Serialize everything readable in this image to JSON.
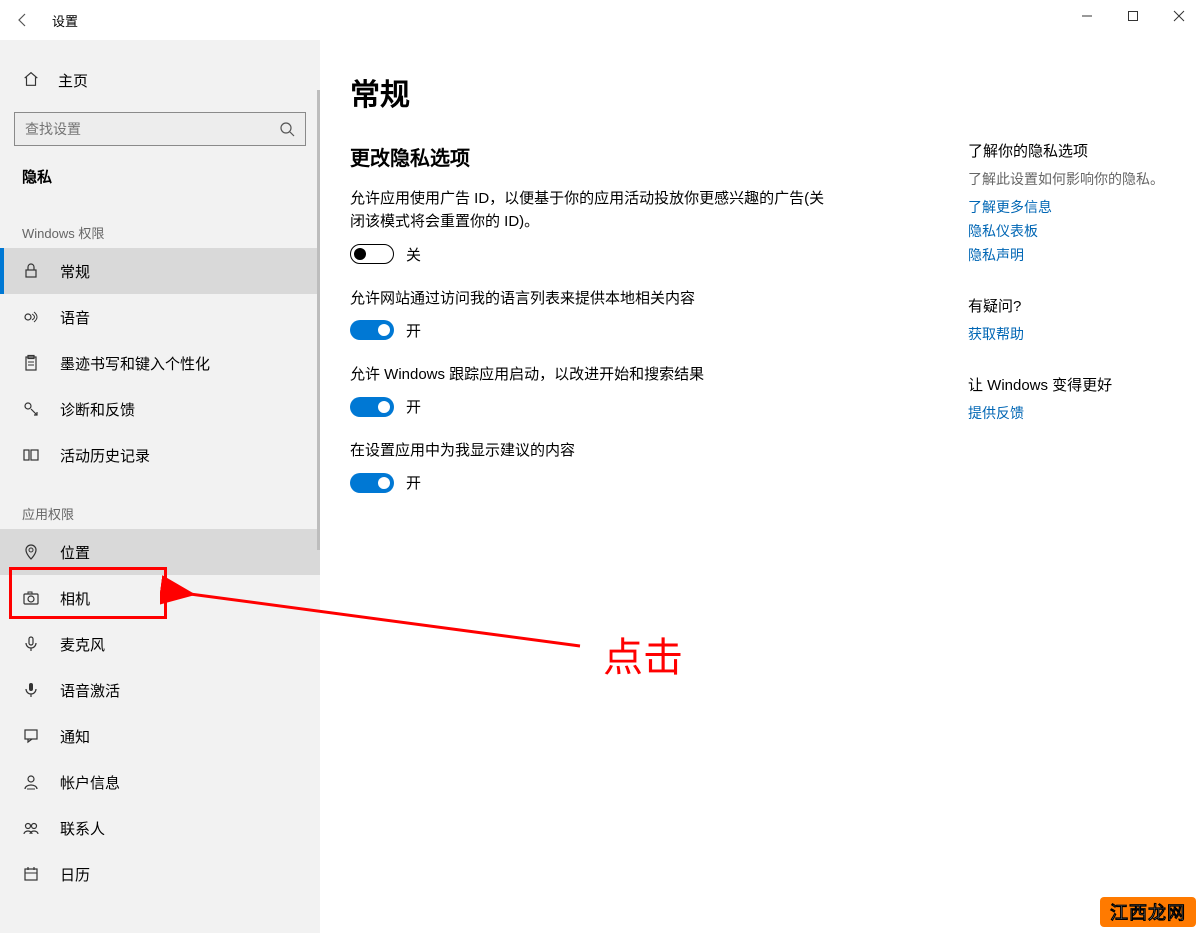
{
  "window": {
    "title": "设置"
  },
  "sidebar": {
    "home": "主页",
    "search_placeholder": "查找设置",
    "section": "隐私",
    "group1": "Windows 权限",
    "items1": [
      {
        "label": "常规"
      },
      {
        "label": "语音"
      },
      {
        "label": "墨迹书写和键入个性化"
      },
      {
        "label": "诊断和反馈"
      },
      {
        "label": "活动历史记录"
      }
    ],
    "group2": "应用权限",
    "items2": [
      {
        "label": "位置"
      },
      {
        "label": "相机"
      },
      {
        "label": "麦克风"
      },
      {
        "label": "语音激活"
      },
      {
        "label": "通知"
      },
      {
        "label": "帐户信息"
      },
      {
        "label": "联系人"
      },
      {
        "label": "日历"
      }
    ]
  },
  "main": {
    "title": "常规",
    "subtitle": "更改隐私选项",
    "settings": [
      {
        "desc": "允许应用使用广告 ID，以便基于你的应用活动投放你更感兴趣的广告(关闭该模式将会重置你的 ID)。",
        "on": false,
        "state": "关"
      },
      {
        "desc": "允许网站通过访问我的语言列表来提供本地相关内容",
        "on": true,
        "state": "开"
      },
      {
        "desc": "允许 Windows 跟踪应用启动，以改进开始和搜索结果",
        "on": true,
        "state": "开"
      },
      {
        "desc": "在设置应用中为我显示建议的内容",
        "on": true,
        "state": "开"
      }
    ]
  },
  "rail": {
    "h1": "了解你的隐私选项",
    "h1_sub": "了解此设置如何影响你的隐私。",
    "links1": [
      "了解更多信息",
      "隐私仪表板",
      "隐私声明"
    ],
    "h2": "有疑问?",
    "links2": [
      "获取帮助"
    ],
    "h3": "让 Windows 变得更好",
    "links3": [
      "提供反馈"
    ]
  },
  "annotation": {
    "click": "点击",
    "watermark": "江西龙网"
  }
}
